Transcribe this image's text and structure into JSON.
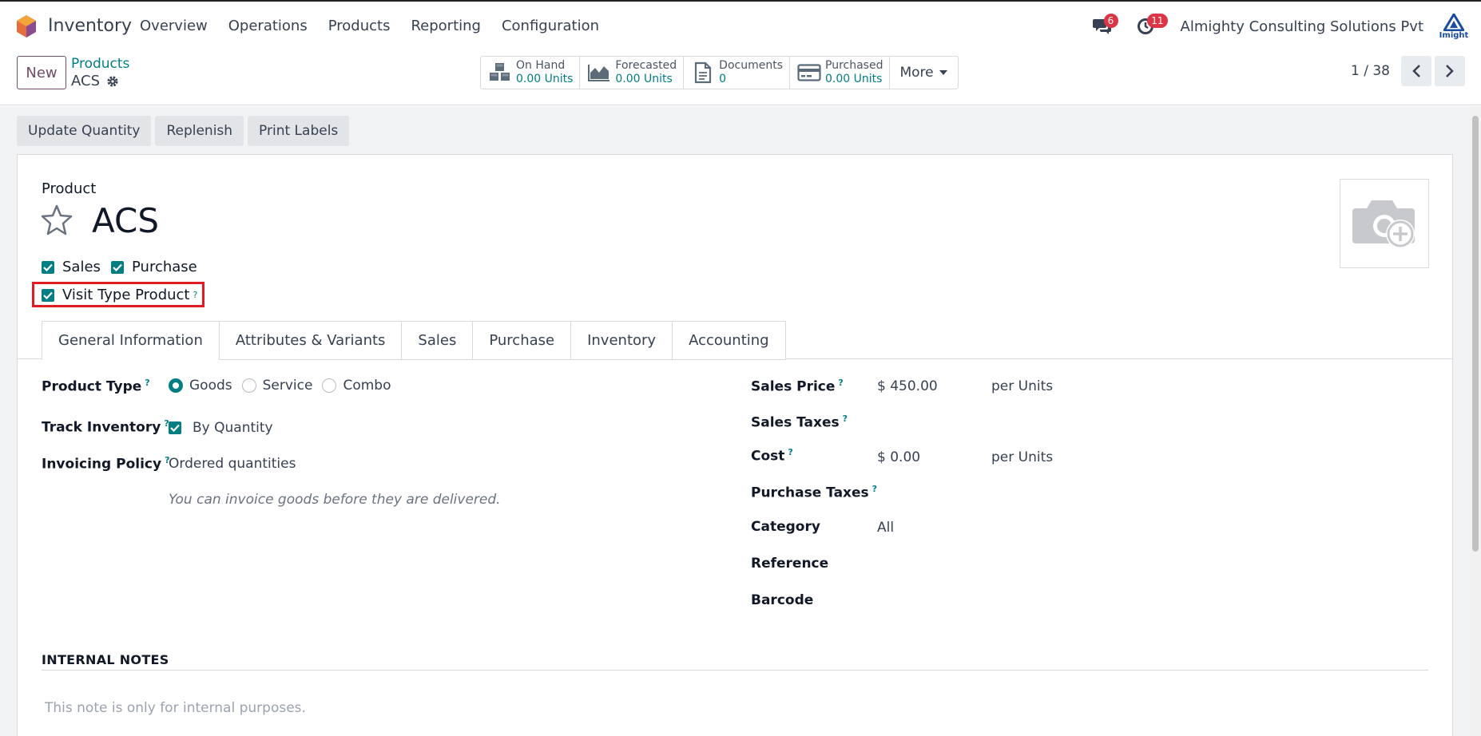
{
  "app": {
    "name": "Inventory"
  },
  "nav": {
    "items": [
      "Overview",
      "Operations",
      "Products",
      "Reporting",
      "Configuration"
    ]
  },
  "systray": {
    "messages_count": "6",
    "activities_count": "11",
    "company": "Almighty Consulting Solutions Pvt",
    "company_logo_text": "Imight"
  },
  "control": {
    "new_label": "New",
    "breadcrumb_parent": "Products",
    "breadcrumb_current": "ACS",
    "pager": "1 / 38"
  },
  "smart_buttons": [
    {
      "label": "On Hand",
      "value": "0.00 Units",
      "icon": "cubes-icon"
    },
    {
      "label": "Forecasted",
      "value": "0.00 Units",
      "icon": "area-chart-icon"
    },
    {
      "label": "Documents",
      "value": "0",
      "icon": "document-icon"
    },
    {
      "label": "Purchased",
      "value": "0.00 Units",
      "icon": "credit-card-icon"
    }
  ],
  "more_label": "More",
  "actions": [
    "Update Quantity",
    "Replenish",
    "Print Labels"
  ],
  "product": {
    "label": "Product",
    "name": "ACS",
    "sales_label": "Sales",
    "purchase_label": "Purchase",
    "visit_type_label": "Visit Type Product",
    "help_mark": "?"
  },
  "tabs": [
    "General Information",
    "Attributes & Variants",
    "Sales",
    "Purchase",
    "Inventory",
    "Accounting"
  ],
  "general": {
    "product_type_label": "Product Type",
    "product_type_options": [
      "Goods",
      "Service",
      "Combo"
    ],
    "track_inventory_label": "Track Inventory",
    "track_inventory_value": "By Quantity",
    "invoicing_policy_label": "Invoicing Policy",
    "invoicing_policy_value": "Ordered quantities",
    "invoicing_hint": "You can invoice goods before they are delivered.",
    "sales_price_label": "Sales Price",
    "sales_price_value": "$ 450.00",
    "sales_price_unit": "per Units",
    "sales_taxes_label": "Sales Taxes",
    "cost_label": "Cost",
    "cost_value": "$ 0.00",
    "cost_unit": "per Units",
    "purchase_taxes_label": "Purchase Taxes",
    "category_label": "Category",
    "category_value": "All",
    "reference_label": "Reference",
    "barcode_label": "Barcode"
  },
  "notes": {
    "title": "INTERNAL NOTES",
    "placeholder": "This note is only for internal purposes."
  },
  "colors": {
    "accent": "#017e84",
    "brand": "#714b67",
    "highlight": "#e01b24",
    "badge": "#dc3545"
  }
}
